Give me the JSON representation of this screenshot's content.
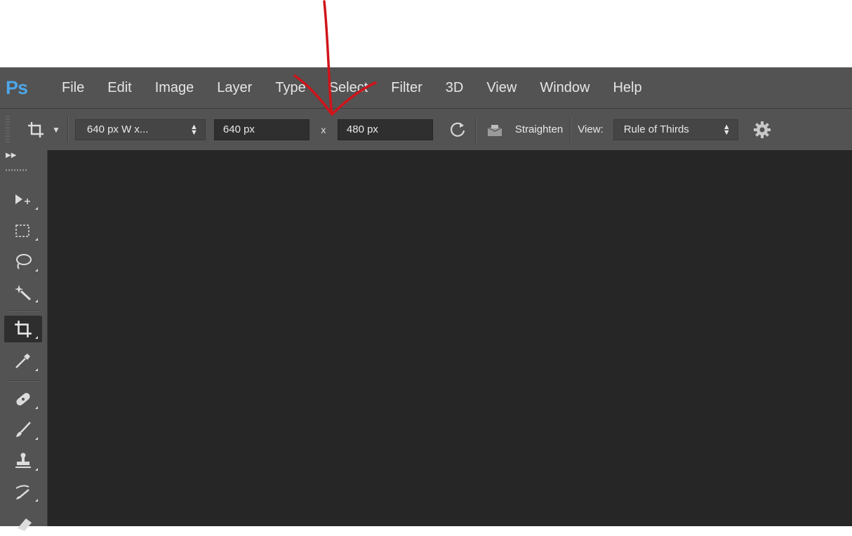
{
  "app": {
    "logo": "Ps"
  },
  "menu": [
    "File",
    "Edit",
    "Image",
    "Layer",
    "Type",
    "Select",
    "Filter",
    "3D",
    "View",
    "Window",
    "Help"
  ],
  "options": {
    "preset_value": "640 px W x...",
    "width_value": "640 px",
    "times": "x",
    "height_value": "480 px",
    "straighten_label": "Straighten",
    "view_label": "View:",
    "view_value": "Rule of Thirds"
  },
  "tools": [
    "move-tool",
    "marquee-tool",
    "lasso-tool",
    "magic-wand-tool",
    "crop-tool",
    "eyedropper-tool",
    "healing-brush-tool",
    "brush-tool",
    "clone-stamp-tool",
    "history-brush-tool",
    "eraser-tool"
  ],
  "colors": {
    "panel": "#535353",
    "canvas": "#262626",
    "logo": "#4da6e8",
    "annotation": "#d0141a"
  }
}
